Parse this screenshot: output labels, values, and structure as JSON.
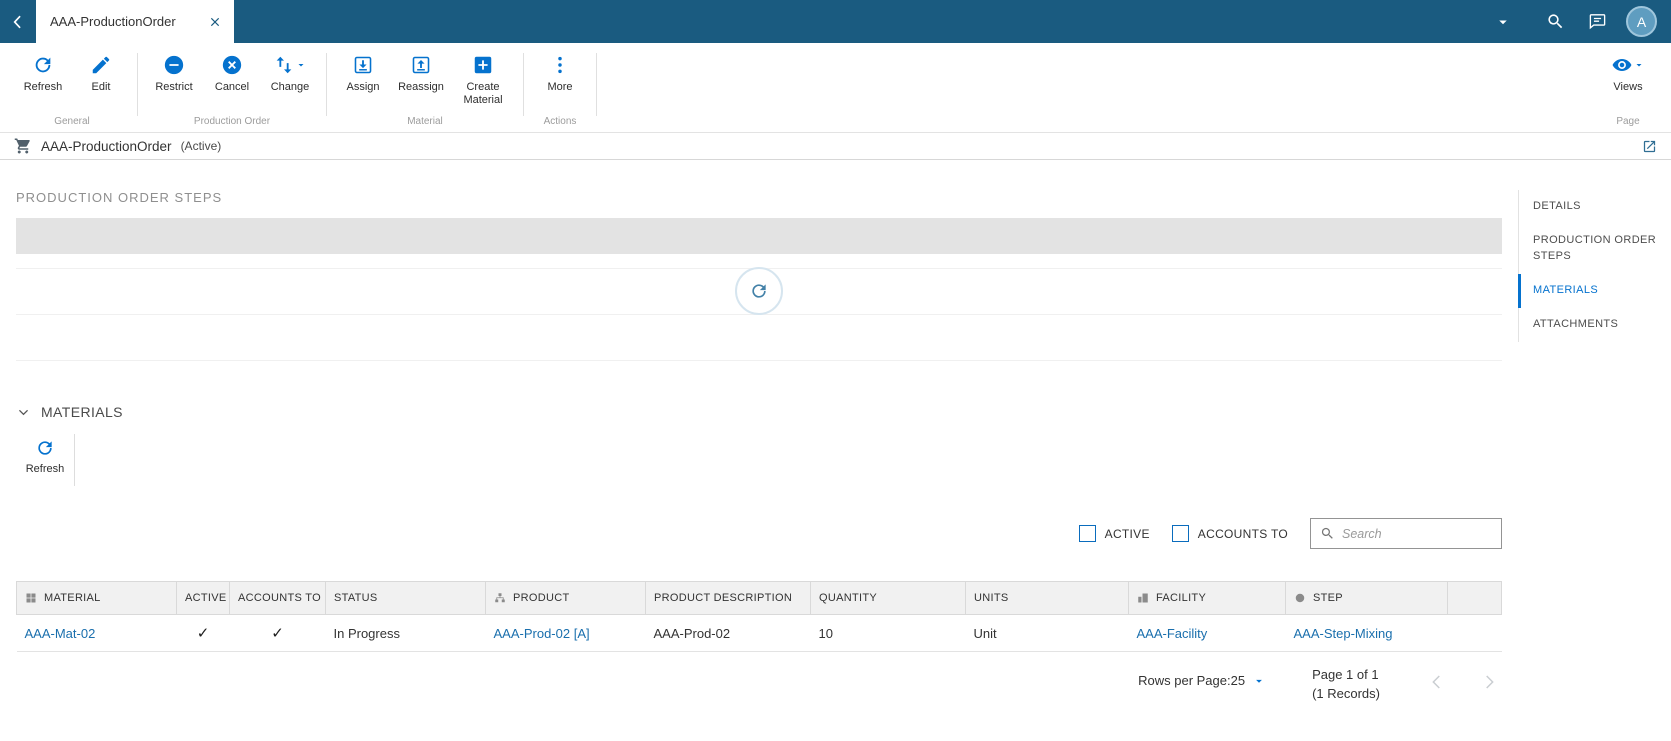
{
  "header": {
    "tab_title": "AAA-ProductionOrder",
    "avatar_initial": "A"
  },
  "toolbar": {
    "groups": [
      {
        "label": "General",
        "buttons": [
          {
            "label": "Refresh",
            "icon": "refresh-icon"
          },
          {
            "label": "Edit",
            "icon": "edit-icon"
          }
        ]
      },
      {
        "label": "Production Order",
        "buttons": [
          {
            "label": "Restrict",
            "icon": "restrict-icon"
          },
          {
            "label": "Cancel",
            "icon": "cancel-icon"
          },
          {
            "label": "Change",
            "icon": "change-icon",
            "has_dropdown": true
          }
        ]
      },
      {
        "label": "Material",
        "buttons": [
          {
            "label": "Assign",
            "icon": "assign-icon"
          },
          {
            "label": "Reassign",
            "icon": "reassign-icon"
          },
          {
            "label": "Create Material",
            "icon": "add-box-icon"
          }
        ]
      },
      {
        "label": "Actions",
        "buttons": [
          {
            "label": "More",
            "icon": "more-icon"
          }
        ]
      },
      {
        "label": "Page",
        "buttons": [
          {
            "label": "Views",
            "icon": "eye-icon",
            "has_dropdown": true
          }
        ]
      }
    ]
  },
  "page": {
    "title": "AAA-ProductionOrder",
    "status": "(Active)"
  },
  "right_nav": {
    "items": [
      {
        "label": "DETAILS",
        "active": false
      },
      {
        "label": "PRODUCTION ORDER STEPS",
        "active": false
      },
      {
        "label": "MATERIALS",
        "active": true
      },
      {
        "label": "ATTACHMENTS",
        "active": false
      }
    ]
  },
  "steps_section": {
    "title": "PRODUCTION ORDER STEPS"
  },
  "materials_section": {
    "title": "MATERIALS",
    "refresh_label": "Refresh",
    "filters": {
      "active_label": "ACTIVE",
      "accounts_to_label": "ACCOUNTS TO",
      "search_placeholder": "Search"
    },
    "table": {
      "columns": [
        "MATERIAL",
        "ACTIVE",
        "ACCOUNTS TO",
        "STATUS",
        "PRODUCT",
        "PRODUCT DESCRIPTION",
        "QUANTITY",
        "UNITS",
        "FACILITY",
        "STEP"
      ],
      "rows": [
        {
          "material": "AAA-Mat-02",
          "active": "✓",
          "accounts_to": "✓",
          "status": "In Progress",
          "product": "AAA-Prod-02 [A]",
          "product_description": "AAA-Prod-02",
          "quantity": "10",
          "units": "Unit",
          "facility": "AAA-Facility",
          "step": "AAA-Step-Mixing"
        }
      ]
    },
    "pagination": {
      "rows_per_page_label": "Rows per Page:",
      "rows_per_page_value": "25",
      "page_info": "Page 1 of 1",
      "records_info": "(1 Records)"
    }
  },
  "colors": {
    "header_bg": "#1a5b80",
    "accent": "#0572ce",
    "link": "#1a6fad",
    "nav_active": "#0572ce"
  }
}
